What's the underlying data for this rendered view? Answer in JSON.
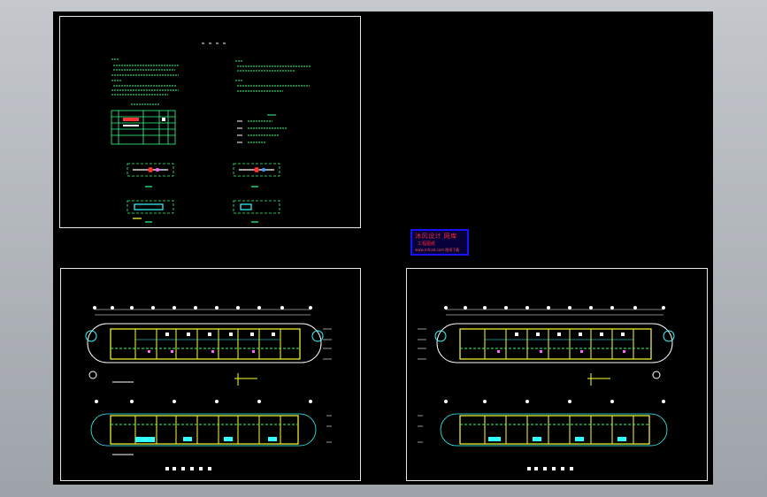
{
  "stamp": {
    "line1": "沐风设计 网库",
    "line2": "工程图纸",
    "line3": "www.mfcad.com 图纸下载"
  },
  "colors": {
    "background": "#000000",
    "sheet_border": "#e8e8e8",
    "wall": "#ffff33",
    "axis": "#ffffff",
    "dimension": "#33ff66",
    "annotation": "#33ffff",
    "stamp_border": "#1414ff",
    "stamp_text": "#ff2b2b"
  },
  "icons": [
    "cad-drawing-sheet",
    "floor-plan",
    "title-block-stamp"
  ]
}
